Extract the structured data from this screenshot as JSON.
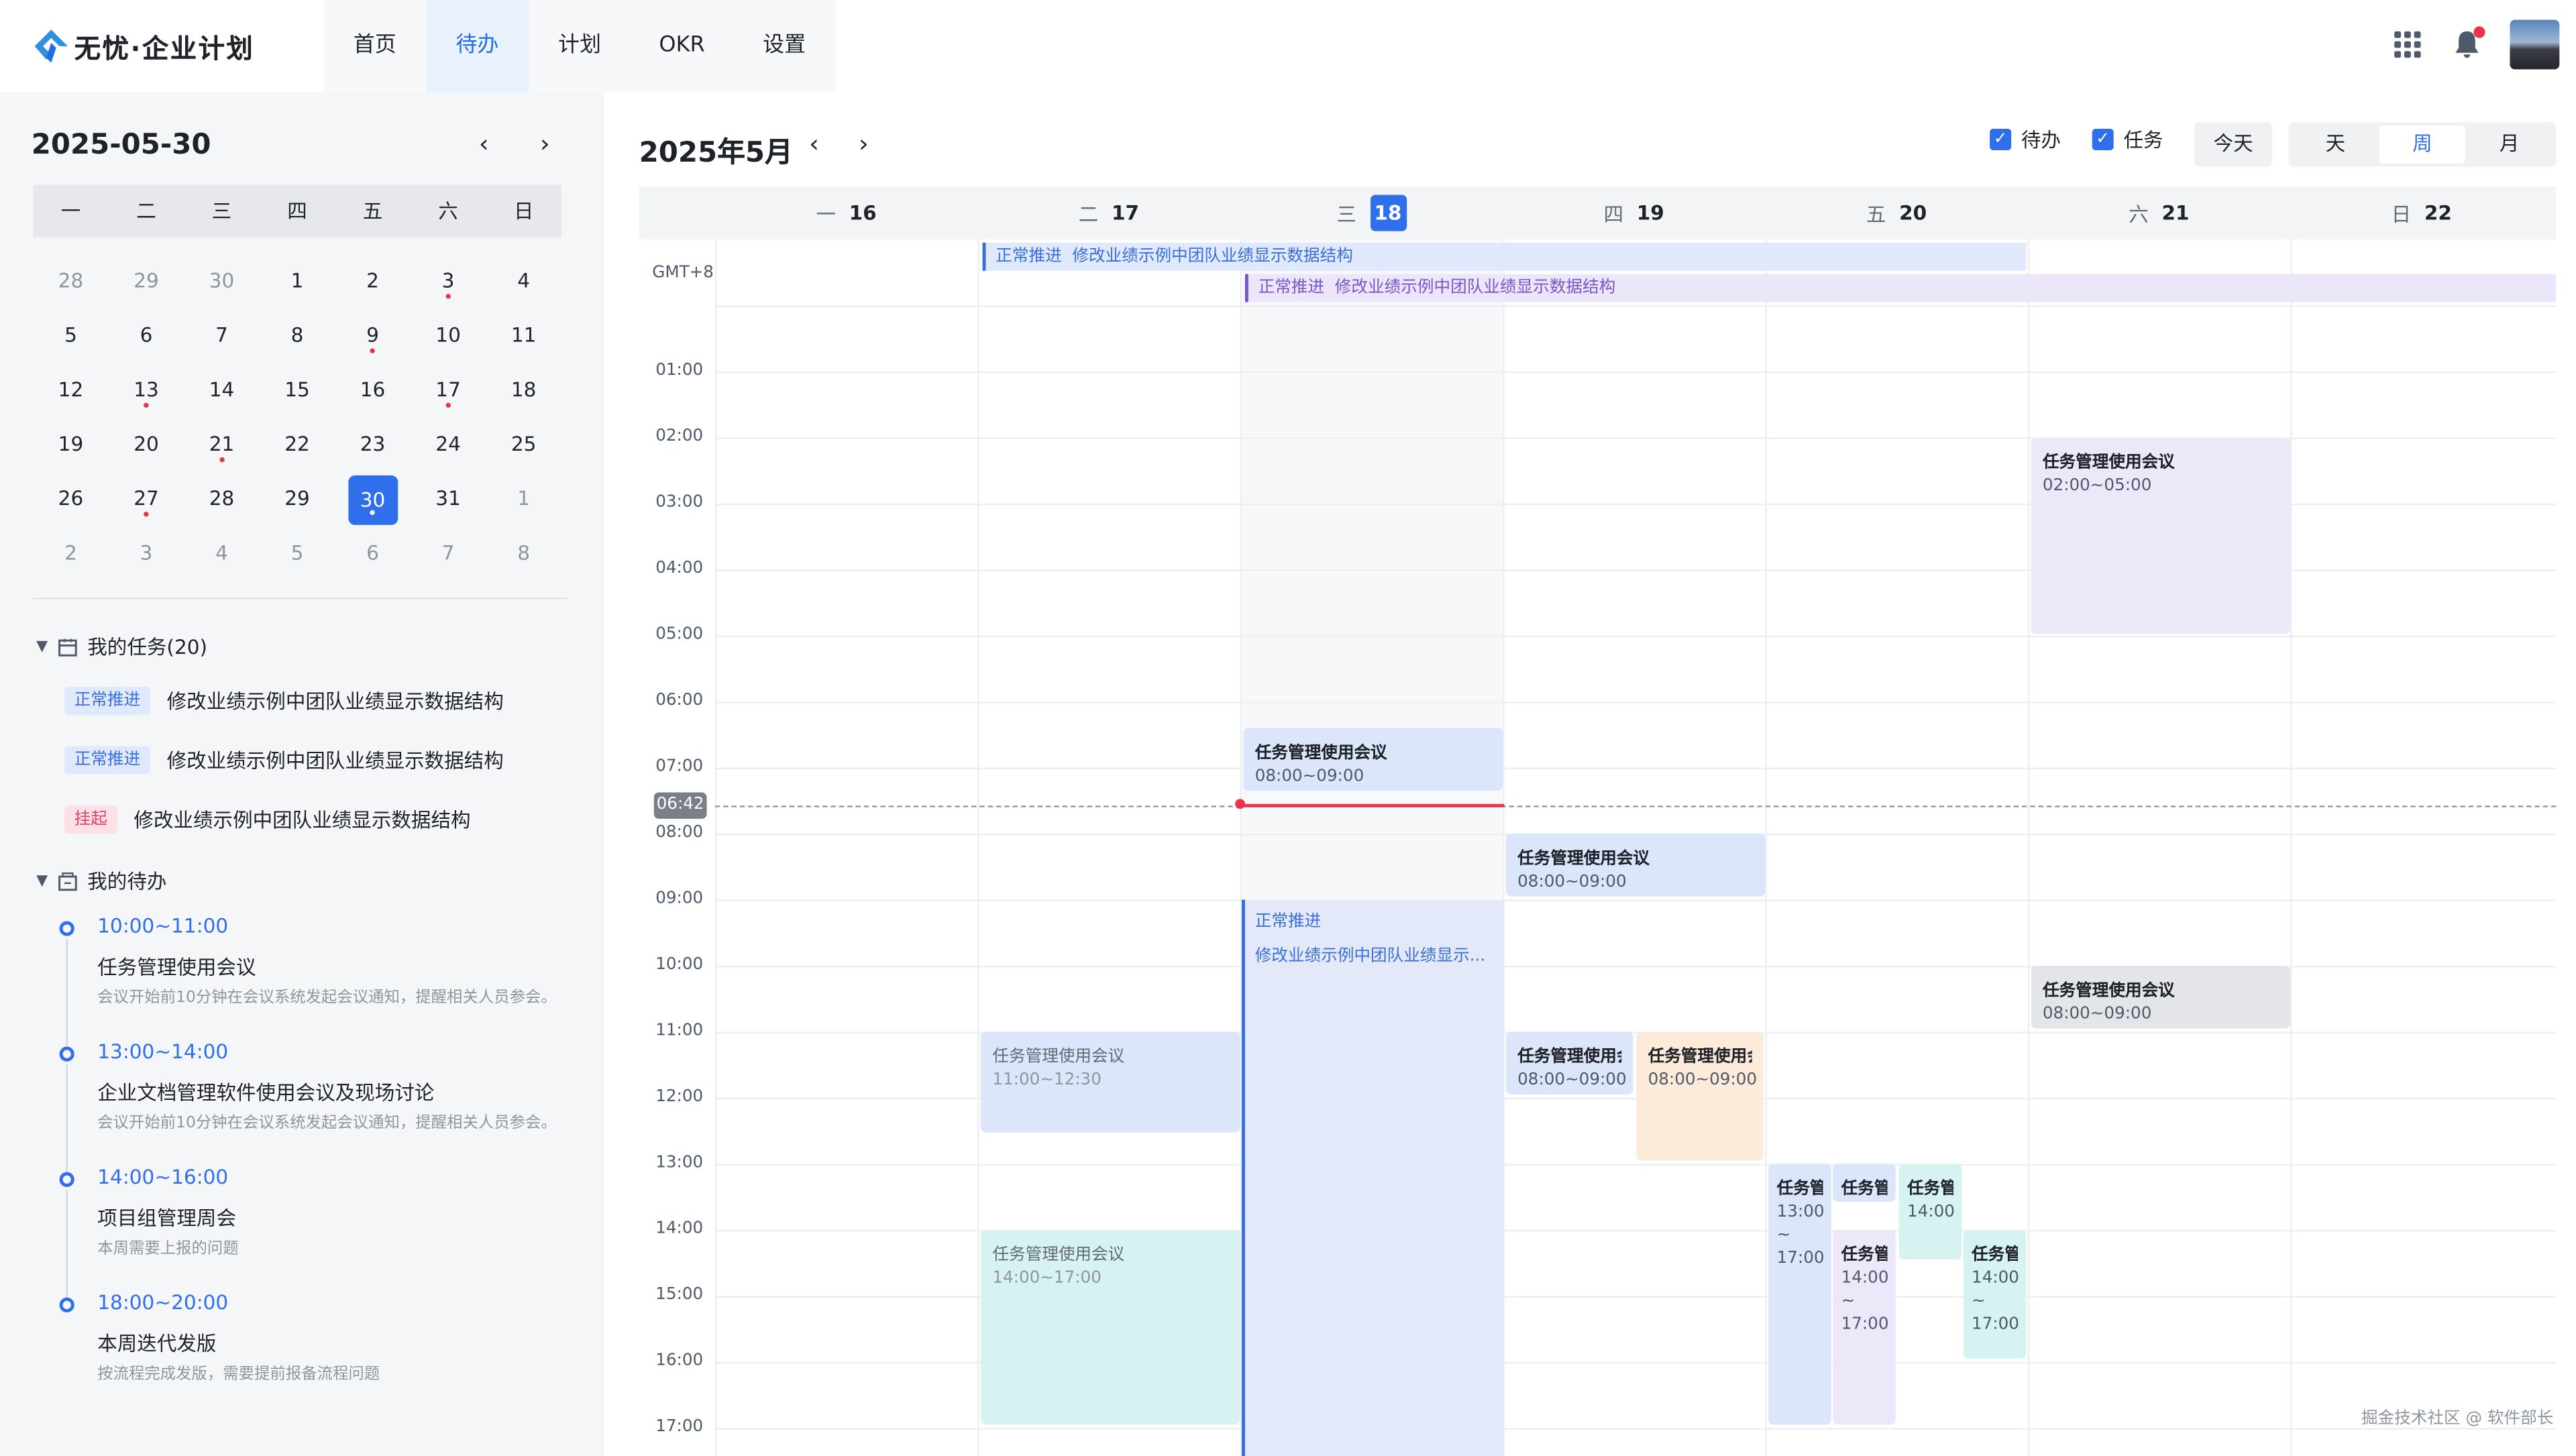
{
  "app": {
    "logo_text": "无忧·企业计划",
    "brand_color": "#2f6fec"
  },
  "nav": [
    {
      "label": "首页",
      "active": false
    },
    {
      "label": "待办",
      "active": true
    },
    {
      "label": "计划",
      "active": false
    },
    {
      "label": "OKR",
      "active": false
    },
    {
      "label": "设置",
      "active": false
    }
  ],
  "top_icons": [
    "apps-grid-icon",
    "bell-icon",
    "avatar"
  ],
  "mini_calendar": {
    "title": "2025-05-30",
    "weekdays": [
      "一",
      "二",
      "三",
      "四",
      "五",
      "六",
      "日"
    ],
    "days": [
      {
        "n": "28",
        "other": true
      },
      {
        "n": "29",
        "other": true
      },
      {
        "n": "30",
        "other": true
      },
      {
        "n": "1"
      },
      {
        "n": "2"
      },
      {
        "n": "3",
        "dot": true
      },
      {
        "n": "4"
      },
      {
        "n": "5"
      },
      {
        "n": "6"
      },
      {
        "n": "7"
      },
      {
        "n": "8"
      },
      {
        "n": "9",
        "dot": true
      },
      {
        "n": "10"
      },
      {
        "n": "11"
      },
      {
        "n": "12"
      },
      {
        "n": "13",
        "dot": true
      },
      {
        "n": "14"
      },
      {
        "n": "15"
      },
      {
        "n": "16"
      },
      {
        "n": "17",
        "dot": true
      },
      {
        "n": "18"
      },
      {
        "n": "19"
      },
      {
        "n": "20"
      },
      {
        "n": "21",
        "dot": true
      },
      {
        "n": "22"
      },
      {
        "n": "23"
      },
      {
        "n": "24"
      },
      {
        "n": "25"
      },
      {
        "n": "26"
      },
      {
        "n": "27",
        "dot": true
      },
      {
        "n": "28"
      },
      {
        "n": "29"
      },
      {
        "n": "30",
        "dot": true,
        "selected": true
      },
      {
        "n": "31"
      },
      {
        "n": "1",
        "other": true
      },
      {
        "n": "2",
        "other": true
      },
      {
        "n": "3",
        "other": true
      },
      {
        "n": "4",
        "other": true
      },
      {
        "n": "5",
        "other": true
      },
      {
        "n": "6",
        "other": true
      },
      {
        "n": "7",
        "other": true
      },
      {
        "n": "8",
        "other": true
      }
    ]
  },
  "my_tasks": {
    "title": "我的任务(20)",
    "items": [
      {
        "tag": "正常推进",
        "tag_color": "blue",
        "text": "修改业绩示例中团队业绩显示数据结构"
      },
      {
        "tag": "正常推进",
        "tag_color": "blue",
        "text": "修改业绩示例中团队业绩显示数据结构"
      },
      {
        "tag": "挂起",
        "tag_color": "red",
        "text": "修改业绩示例中团队业绩显示数据结构"
      }
    ]
  },
  "my_todos": {
    "title": "我的待办",
    "items": [
      {
        "time": "10:00~11:00",
        "title": "任务管理使用会议",
        "desc": "会议开始前10分钟在会议系统发起会议通知，提醒相关人员参会。"
      },
      {
        "time": "13:00~14:00",
        "title": "企业文档管理软件使用会议及现场讨论",
        "desc": "会议开始前10分钟在会议系统发起会议通知，提醒相关人员参会。"
      },
      {
        "time": "14:00~16:00",
        "title": "项目组管理周会",
        "desc": "本周需要上报的问题"
      },
      {
        "time": "18:00~20:00",
        "title": "本周迭代发版",
        "desc": "按流程完成发版，需要提前报备流程问题"
      }
    ]
  },
  "main": {
    "title": "2025年5月",
    "filters": [
      {
        "label": "待办",
        "checked": true
      },
      {
        "label": "任务",
        "checked": true
      }
    ],
    "today_label": "今天",
    "views": [
      {
        "label": "天"
      },
      {
        "label": "周",
        "active": true
      },
      {
        "label": "月"
      }
    ],
    "week": [
      {
        "wd": "一",
        "d": "16"
      },
      {
        "wd": "二",
        "d": "17"
      },
      {
        "wd": "三",
        "d": "18",
        "today": true
      },
      {
        "wd": "四",
        "d": "19"
      },
      {
        "wd": "五",
        "d": "20"
      },
      {
        "wd": "六",
        "d": "21"
      },
      {
        "wd": "日",
        "d": "22"
      }
    ],
    "timezone": "GMT+8",
    "hours": [
      "01:00",
      "02:00",
      "03:00",
      "04:00",
      "05:00",
      "06:00",
      "07:00",
      "08:00",
      "09:00",
      "10:00",
      "11:00",
      "12:00",
      "13:00",
      "14:00",
      "15:00",
      "16:00",
      "17:00"
    ],
    "now_label": "06:42",
    "allday_events": [
      {
        "tag": "正常推进",
        "text": "修改业绩示例中团队业绩显示数据结构",
        "color": "blue"
      },
      {
        "tag": "正常推进",
        "text": "修改业绩示例中团队业绩显示数据结构",
        "color": "purple"
      }
    ],
    "long_task": {
      "tag": "正常推进",
      "text": "修改业绩示例中团队业绩显示..."
    },
    "events": [
      {
        "title": "任务管理使用会议",
        "time": "02:00~05:00",
        "color": "purple"
      },
      {
        "title": "任务管理使用会议",
        "time": "08:00~09:00",
        "color": "blue"
      },
      {
        "title": "任务管理使用会议",
        "time": "08:00~09:00",
        "color": "blue"
      },
      {
        "title": "任务管理使用会议",
        "time": "08:00~09:00",
        "color": "gray"
      },
      {
        "title": "任务管理使用会议",
        "time": "11:00~12:30",
        "color": "blue"
      },
      {
        "title": "任务管理使用会议",
        "time": "08:00~09:00",
        "color": "blue"
      },
      {
        "title": "任务管理使用会议",
        "time": "08:00~09:00",
        "color": "orange"
      },
      {
        "title": "任务管理使用会议",
        "time": "14:00~17:00",
        "color": "cyan"
      },
      {
        "title": "任务管",
        "time": "13:00\n~\n17:00",
        "color": "blue"
      },
      {
        "title": "任务管",
        "time": "",
        "color": "blue"
      },
      {
        "title": "任务管",
        "time": "14:00\n~\n17:00",
        "color": "purple"
      },
      {
        "title": "任务管",
        "time": "14:00",
        "color": "cyan"
      },
      {
        "title": "任务管",
        "time": "14:00\n~\n17:00",
        "color": "cyan"
      }
    ]
  },
  "watermark": "掘金技术社区 @ 软件部长"
}
